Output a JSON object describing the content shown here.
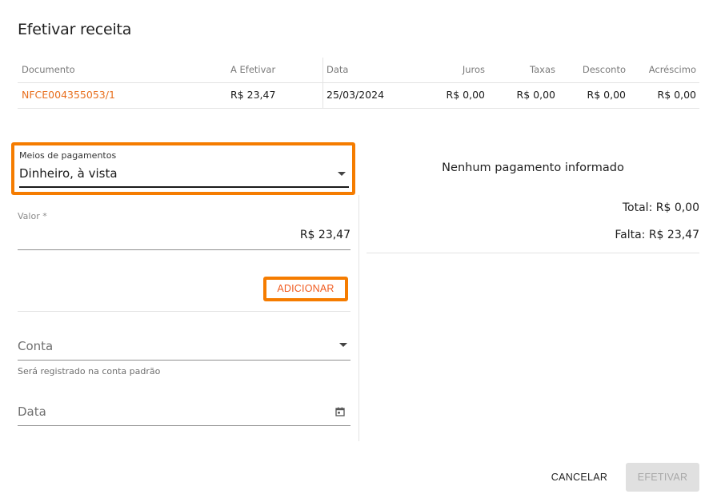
{
  "dialog": {
    "title": "Efetivar receita"
  },
  "table": {
    "headers": [
      "Documento",
      "A Efetivar",
      "Data",
      "Juros",
      "Taxas",
      "Desconto",
      "Acréscimo"
    ],
    "row": {
      "documento": "NFCE004355053/1",
      "a_efetivar": "R$ 23,47",
      "data": "25/03/2024",
      "juros": "R$ 0,00",
      "taxas": "R$ 0,00",
      "desconto": "R$ 0,00",
      "acrescimo": "R$ 0,00"
    }
  },
  "form": {
    "payment_method": {
      "label": "Meios de pagamentos",
      "value": "Dinheiro, à vista"
    },
    "valor": {
      "label": "Valor *",
      "value": "R$ 23,47"
    },
    "add_label": "ADICIONAR",
    "conta": {
      "placeholder": "Conta",
      "helper": "Será registrado na conta padrão"
    },
    "data": {
      "placeholder": "Data"
    }
  },
  "summary": {
    "empty_message": "Nenhum pagamento informado",
    "total": "Total: R$ 0,00",
    "falta": "Falta: R$ 23,47"
  },
  "actions": {
    "cancel": "CANCELAR",
    "confirm": "EFETIVAR"
  },
  "colors": {
    "accent": "#e86f1e",
    "highlight": "#f57c00",
    "disabled_bg": "#e0e0e0"
  }
}
